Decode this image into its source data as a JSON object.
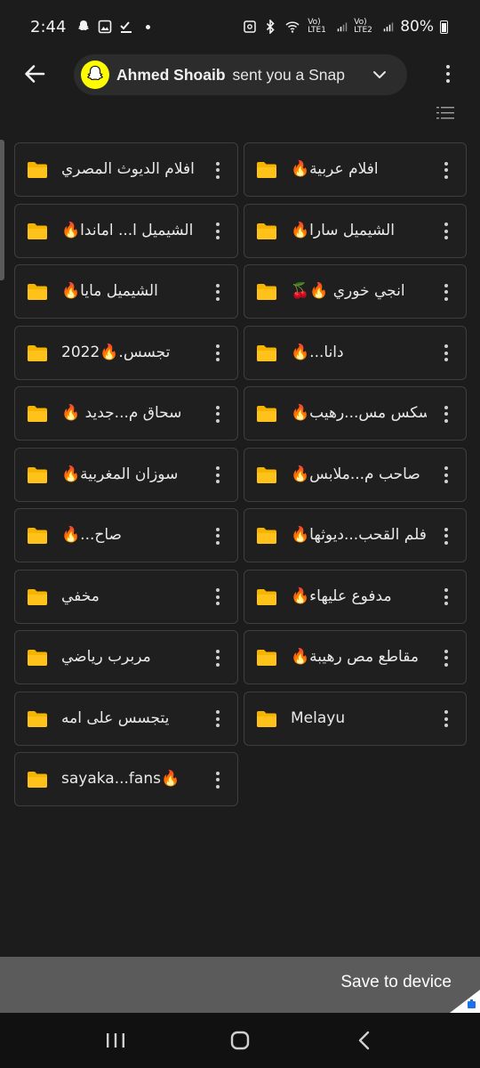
{
  "status_bar": {
    "time": "2:44",
    "battery": "80%",
    "network_labels": [
      "Vo) LTE1",
      "Vo) LTE2"
    ]
  },
  "snap_banner": {
    "sender": "Ahmed Shoaib",
    "message": "sent you a Snap"
  },
  "folders": [
    {
      "name": "افلام الديوث المصري"
    },
    {
      "name": "🔥افلام عربية"
    },
    {
      "name": "🔥الشيميل ا... اماندا"
    },
    {
      "name": "🔥الشيميل سارا"
    },
    {
      "name": "🔥الشيميل مايا"
    },
    {
      "name": "🍒🔥 انجي خوري"
    },
    {
      "name": "تجسس.🔥2022"
    },
    {
      "name": "🔥...دانا"
    },
    {
      "name": "🔥 سحاق م...جديد"
    },
    {
      "name": "🔥سكس مس...رهيب"
    },
    {
      "name": "🔥سوزان المغربية"
    },
    {
      "name": "🔥صاحب م...ملابس"
    },
    {
      "name": "🔥...صاح"
    },
    {
      "name": "🔥فلم القحب...ديوثها"
    },
    {
      "name": "مخفي"
    },
    {
      "name": "🔥مدفوع عليهاء"
    },
    {
      "name": "مربرب رياضي"
    },
    {
      "name": "🔥مقاطع مص رهيبة"
    },
    {
      "name": "يتجسس على امه"
    },
    {
      "name": "Melayu"
    },
    {
      "name": "sayaka...fans🔥"
    }
  ],
  "bottom_bar": {
    "save_label": "Save to device"
  },
  "colors": {
    "background": "#1c1c1c",
    "folder_icon": "#f6b400",
    "snap_yellow": "#fffc00",
    "save_bar": "#5b5b5b"
  }
}
